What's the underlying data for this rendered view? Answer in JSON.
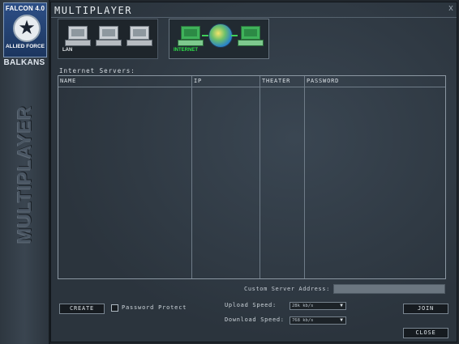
{
  "sidebar": {
    "logo_top": "FALCON 4.0",
    "logo_star": "★",
    "logo_bottom": "ALLIED FORCE",
    "logo_sub": "BALKANS",
    "vertical_title": "MULTIPLAYER"
  },
  "window": {
    "title": "MULTIPLAYER",
    "close_glyph": "x"
  },
  "modes": {
    "lan_label": "LAN",
    "internet_label": "INTERNET"
  },
  "servers": {
    "section_label": "Internet Servers:",
    "columns": [
      "NAME",
      "IP",
      "THEATER",
      "PASSWORD"
    ],
    "rows": []
  },
  "custom_address": {
    "label": "Custom Server Address:",
    "value": ""
  },
  "buttons": {
    "create": "CREATE",
    "join": "JOIN",
    "close": "CLOSE"
  },
  "password_protect": {
    "label": "Password Protect",
    "checked": false
  },
  "speeds": {
    "upload_label": "Upload Speed:",
    "upload_value": "28k kb/s",
    "download_label": "Download Speed:",
    "download_value": "768 kb/s"
  },
  "icons": {
    "dropdown": "▼"
  },
  "colors": {
    "internet_accent": "#2ee04a",
    "logo_blue": "#2d4f86"
  }
}
